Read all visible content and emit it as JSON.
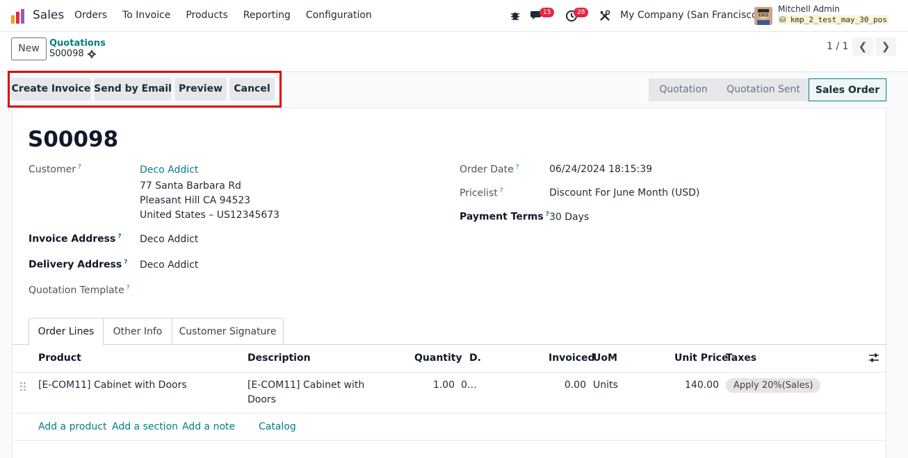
{
  "navbar": {
    "app_name": "Sales",
    "menu": [
      "Orders",
      "To Invoice",
      "Products",
      "Reporting",
      "Configuration"
    ],
    "messages_count": "15",
    "activities_count": "28",
    "company": "My Company (San Francisco)",
    "user_name": "Mitchell Admin",
    "database": "kmp_2_test_may_30_pos"
  },
  "control": {
    "new_label": "New",
    "breadcrumb": "Quotations",
    "record": "S00098",
    "pager": "1 / 1"
  },
  "actions": {
    "create_invoice": "Create Invoice",
    "send_email": "Send by Email",
    "preview": "Preview",
    "cancel": "Cancel"
  },
  "statusbar": {
    "quotation": "Quotation",
    "quotation_sent": "Quotation Sent",
    "sales_order": "Sales Order"
  },
  "form": {
    "title": "S00098",
    "customer_label": "Customer",
    "customer_name": "Deco Addict",
    "address_line1": "77 Santa Barbara Rd",
    "address_line2": "Pleasant Hill CA 94523",
    "address_line3": "United States – US12345673",
    "invoice_address_label": "Invoice Address",
    "invoice_address": "Deco Addict",
    "delivery_address_label": "Delivery Address",
    "delivery_address": "Deco Addict",
    "template_label": "Quotation Template",
    "order_date_label": "Order Date",
    "order_date": "06/24/2024 18:15:39",
    "pricelist_label": "Pricelist",
    "pricelist": "Discount For June Month (USD)",
    "payment_terms_label": "Payment Terms",
    "payment_terms": "30 Days",
    "help_mark": "?"
  },
  "tabs": [
    "Order Lines",
    "Other Info",
    "Customer Signature"
  ],
  "table": {
    "headers": {
      "product": "Product",
      "description": "Description",
      "quantity": "Quantity",
      "delivered": "D.",
      "invoiced": "Invoiced",
      "uom": "UoM",
      "unit_price": "Unit Price",
      "taxes": "Taxes"
    },
    "rows": [
      {
        "product": "[E-COM11] Cabinet with Doors",
        "description_line1": "[E-COM11] Cabinet with",
        "description_line2": "Doors",
        "quantity": "1.00",
        "delivered": "0…",
        "invoiced": "0.00",
        "uom": "Units",
        "unit_price": "140.00",
        "tax": "Apply 20%(Sales)"
      }
    ],
    "add_product": "Add a product",
    "add_section": "Add a section",
    "add_note": "Add a note",
    "catalog": "Catalog"
  },
  "colors": {
    "accent": "#017e84",
    "badge": "#e0293f",
    "highlight": "#e00000"
  }
}
